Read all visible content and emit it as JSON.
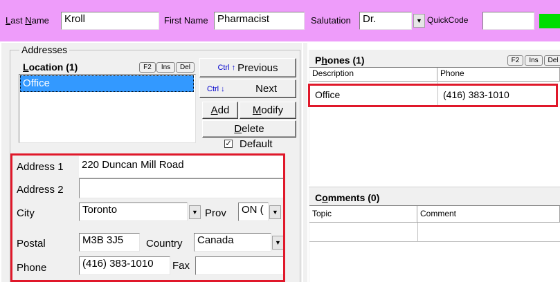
{
  "header": {
    "last_name_label": "Last Name",
    "last_name_value": "Kroll",
    "first_name_label": "First Name",
    "first_name_value": "Pharmacist",
    "salutation_label": "Salutation",
    "salutation_value": "Dr.",
    "quickcode_label": "QuickCode",
    "quickcode_value": "",
    "bg_color": "#ee9cfa",
    "status_color": "#00dd00"
  },
  "addresses": {
    "group_label": "Addresses",
    "location_header": "Location (1)",
    "locations": [
      "Office"
    ],
    "shortcut_keys": [
      "F2",
      "Ins",
      "Del"
    ],
    "previous_label": "Previous",
    "previous_shortcut": "Ctrl ↑",
    "next_label": "Next",
    "next_shortcut": "Ctrl ↓",
    "add_label": "Add",
    "modify_label": "Modify",
    "delete_label": "Delete",
    "default_label": "Default",
    "default_checked": true
  },
  "address_form": {
    "address1_label": "Address 1",
    "address1_value": "220 Duncan Mill Road",
    "address2_label": "Address 2",
    "address2_value": "",
    "city_label": "City",
    "city_value": "Toronto",
    "prov_label": "Prov",
    "prov_value": "ON (",
    "postal_label": "Postal",
    "postal_value": "M3B 3J5",
    "country_label": "Country",
    "country_value": "Canada",
    "phone_label": "Phone",
    "phone_value": "(416) 383-1010",
    "fax_label": "Fax",
    "fax_value": ""
  },
  "phones": {
    "header": "Phones (1)",
    "shortcut_keys": [
      "F2",
      "Ins",
      "Del"
    ],
    "columns": [
      "Description",
      "Phone"
    ],
    "rows": [
      [
        "Office",
        "(416) 383-1010"
      ]
    ]
  },
  "comments": {
    "header": "Comments (0)",
    "columns": [
      "Topic",
      "Comment"
    ]
  },
  "highlight_color": "#e0182a",
  "selection_color": "#3399ff"
}
